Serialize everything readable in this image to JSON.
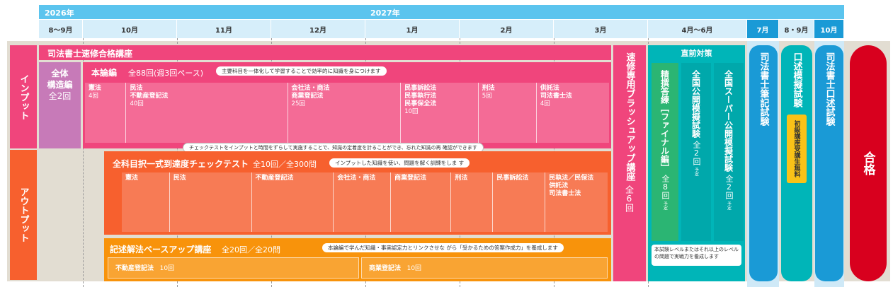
{
  "header": {
    "year1": "2026年",
    "year2": "2027年",
    "months": [
      "8～9月",
      "10月",
      "11月",
      "12月",
      "1月",
      "2月",
      "3月",
      "4月～6月",
      "7月",
      "8・9月",
      "10月"
    ]
  },
  "side": {
    "input": "インプット",
    "output": "アウトプット"
  },
  "course": {
    "title": "司法書士速修合格講座",
    "zentai": {
      "line1": "全体",
      "line2": "構造編",
      "line3": "全2回"
    },
    "honron": {
      "title": "本論編",
      "count": "全88回(週3回ペース)",
      "note": "主要科目を一体化して学習することで効率的に知識を身につけます",
      "subjects": [
        {
          "name": "憲法",
          "count": "4回"
        },
        {
          "name": "民法\n不動産登記法",
          "count": "40回"
        },
        {
          "name": "会社法・商法\n商業登記法",
          "count": "25回"
        },
        {
          "name": "民事訴訟法\n民事執行法\n民事保全法",
          "count": "10回"
        },
        {
          "name": "刑法",
          "count": "5回"
        },
        {
          "name": "供託法\n司法書士法",
          "count": "4回"
        }
      ]
    },
    "check_note": "チェックテストをインプットと時間をずらして実施することで、知識の定着度を計ることができ、忘れた知識の再 確認ができます",
    "check": {
      "title": "全科目択一式到達度チェックテスト",
      "count": "全10回／全300問",
      "note": "インプットした知識を使い、問題を解く訓練をしま す",
      "subjects": [
        "憲法",
        "民法",
        "不動産登記法",
        "会社法・商法",
        "商業登記法",
        "刑法",
        "民事訴訟法",
        "民執法／民保法\n供託法\n司法書士法"
      ]
    },
    "kijutsu": {
      "title": "記述解法ベースアップ講座",
      "count": "全20回／全20問",
      "note": "本論編で学んだ知識・事実認定力とリンクさせな がら「受かるための答案作成力」を養成します",
      "items": [
        {
          "name": "不動産登記法",
          "count": "10回"
        },
        {
          "name": "商業登記法",
          "count": "10回"
        }
      ]
    }
  },
  "brush": {
    "title": "速修専用ブラッシュアップ講座",
    "count": "全6回"
  },
  "chokuzen": {
    "title": "直前対策",
    "final": {
      "title": "精撰答練［ファイナル編］",
      "count": "全8回",
      "note": "予定"
    },
    "zenkoku": {
      "title": "全国公開模擬試験",
      "count": "全2回",
      "note": "予定"
    },
    "super": {
      "title": "全国スーパー公開模擬試験",
      "count": "全2回",
      "note": "予定"
    },
    "note": "本試験レベルまたはそれ以上のレベルの問題で実戦力を養成します"
  },
  "exam1": "司法書士筆記試験",
  "mock": {
    "title": "口述模擬試験",
    "badge": "初級講座受講生無料"
  },
  "exam2": "司法書士口述試験",
  "pass": "合格",
  "colors": {
    "pink": "#f0457c",
    "coral": "#f7602e",
    "orange": "#f8930b",
    "teal": "#00b5b8",
    "green": "#2bb573",
    "blue": "#1a9ad6",
    "red": "#d8001e",
    "purple": "#c77ab8",
    "gray": "#e2ddd2"
  }
}
